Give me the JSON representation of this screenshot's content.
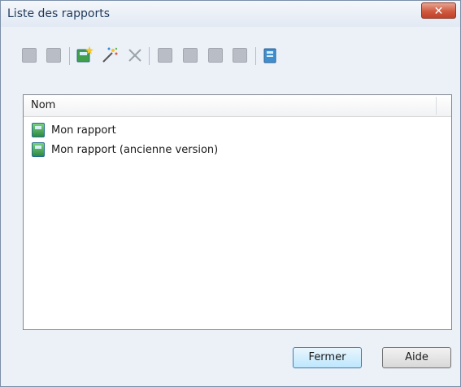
{
  "window": {
    "title": "Liste des rapports",
    "close_label": "✕"
  },
  "toolbar": {
    "items": [
      {
        "name": "disabled-doc-icon",
        "state": "disabled"
      },
      {
        "name": "disabled-doc-icon",
        "state": "disabled"
      },
      {
        "name": "separator"
      },
      {
        "name": "new-report-icon",
        "state": "enabled"
      },
      {
        "name": "wizard-icon",
        "state": "enabled"
      },
      {
        "name": "delete-icon",
        "state": "disabled"
      },
      {
        "name": "separator"
      },
      {
        "name": "preview-icon",
        "state": "disabled"
      },
      {
        "name": "print-icon",
        "state": "disabled"
      },
      {
        "name": "doc-icon",
        "state": "disabled"
      },
      {
        "name": "doc-icon",
        "state": "disabled"
      },
      {
        "name": "separator"
      },
      {
        "name": "copy-icon",
        "state": "enabled"
      }
    ]
  },
  "list": {
    "column_header": "Nom",
    "items": [
      {
        "label": "Mon rapport",
        "icon": "report-icon"
      },
      {
        "label": "Mon rapport (ancienne version)",
        "icon": "report-old-icon"
      }
    ]
  },
  "buttons": {
    "close_label": "Fermer",
    "help_label": "Aide"
  },
  "colors": {
    "accent": "#3c7fb1",
    "close_red": "#c0412a"
  }
}
